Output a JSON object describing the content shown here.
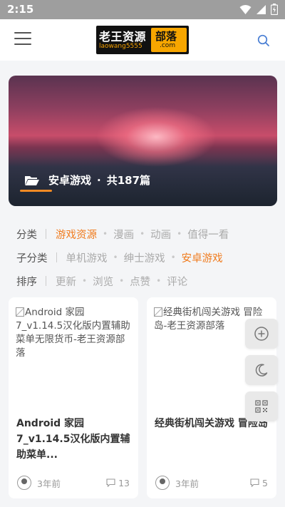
{
  "status_bar": {
    "time": "2:15",
    "icons": [
      "wifi-icon",
      "signal-icon",
      "battery-icon"
    ]
  },
  "header": {
    "logo_main": "老王资源",
    "logo_badge": "部落",
    "logo_sub": "laowang5555",
    "logo_com": ".com",
    "icons": [
      "menu-icon",
      "search-icon"
    ]
  },
  "banner": {
    "category": "安卓游戏",
    "count_text": "共187篇",
    "accent_color": "#f08a24"
  },
  "filters": {
    "category": {
      "label": "分类",
      "options": [
        "游戏资源",
        "漫画",
        "动画",
        "值得一看"
      ],
      "active_index": 0
    },
    "subcategory": {
      "label": "子分类",
      "options": [
        "单机游戏",
        "绅士游戏",
        "安卓游戏"
      ],
      "active_index": 2
    },
    "sort": {
      "label": "排序",
      "options": [
        "更新",
        "浏览",
        "点赞",
        "评论"
      ]
    },
    "active_color": "#f07c1f"
  },
  "cards": [
    {
      "thumb_alt": "Android 家园7_v1.14.5汉化版内置辅助菜单无限货币-老王资源部落",
      "title": "Android 家园7_v1.14.5汉化版内置辅助菜单...",
      "time": "3年前",
      "comments": "13"
    },
    {
      "thumb_alt": "经典街机闯关游戏 冒险岛-老王资源部落",
      "title": "经典街机闯关游戏 冒险岛",
      "time": "3年前",
      "comments": "5"
    }
  ],
  "float_tools": [
    "add-icon",
    "moon-icon",
    "qrcode-icon"
  ]
}
